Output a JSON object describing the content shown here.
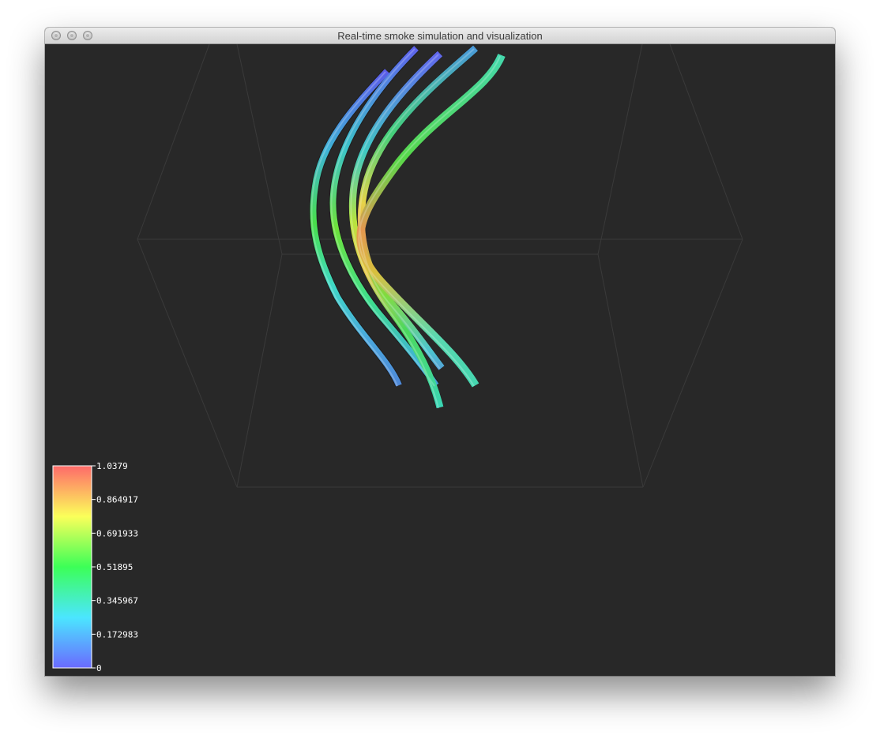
{
  "window": {
    "title": "Real-time smoke simulation and visualization",
    "controls": [
      "close-icon",
      "minimize-icon",
      "zoom-icon"
    ]
  },
  "scene": {
    "background_color": "#282828",
    "box_color": "#3a3a3a",
    "tube_count": 6
  },
  "colorbar": {
    "colors": [
      "#6a6aff",
      "#4be6ff",
      "#3cff57",
      "#fbff5a",
      "#ff6a6a"
    ],
    "ticks": [
      "1.0379",
      "0.864917",
      "0.691933",
      "0.51895",
      "0.345967",
      "0.172983",
      "0"
    ]
  }
}
